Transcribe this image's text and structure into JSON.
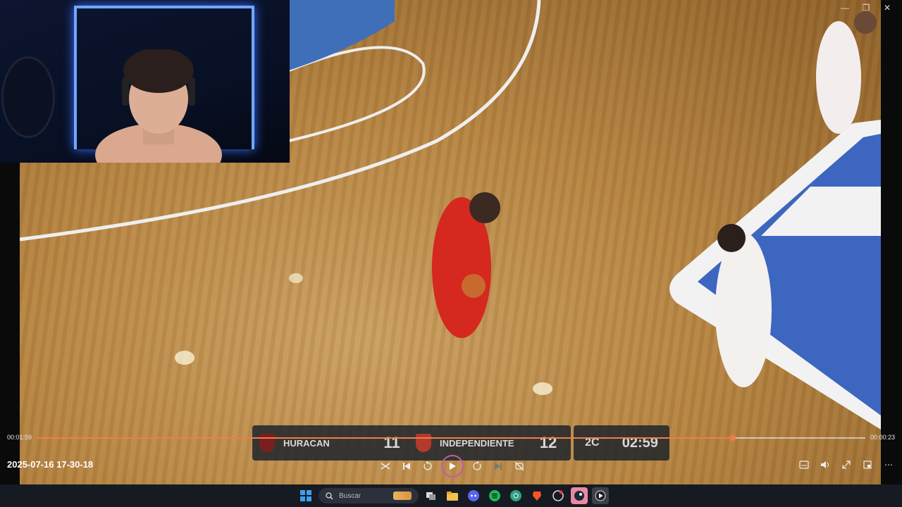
{
  "window": {
    "minimize_icon": "minimize-icon",
    "restore_icon": "restore-icon",
    "close_icon": "close-icon"
  },
  "scoreboard": {
    "home_team": "HURACAN",
    "home_score": "11",
    "away_team": "INDEPENDIENTE",
    "away_score": "12",
    "period": "2C",
    "clock": "02:59"
  },
  "player": {
    "title": "2025-07-16 17-30-18",
    "elapsed": "00:01:59",
    "remaining": "00:00:23",
    "progress": 0.84,
    "accent_color": "#f07d46",
    "controls": [
      "shuffle-icon",
      "previous-icon",
      "rewind-10-icon",
      "play-icon",
      "forward-30-icon",
      "next-icon",
      "repeat-off-icon"
    ],
    "right_controls": [
      "subtitles-icon",
      "volume-icon",
      "fullscreen-icon",
      "miniplayer-icon",
      "more-icon"
    ]
  },
  "taskbar": {
    "search_placeholder": "Buscar",
    "apps": [
      "windows-start-icon",
      "task-view-icon",
      "file-explorer-icon",
      "discord-icon",
      "spotify-icon",
      "chrome-icon",
      "brave-icon",
      "game-icon",
      "steam-icon",
      "media-player-icon"
    ]
  }
}
